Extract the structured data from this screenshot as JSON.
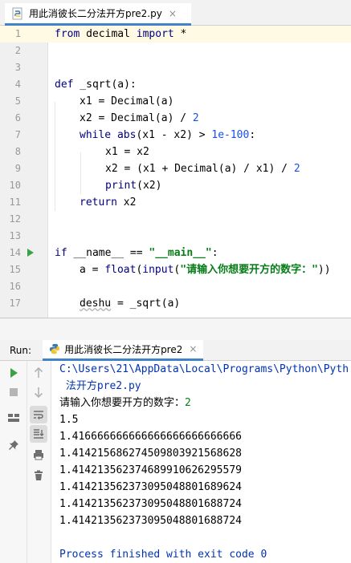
{
  "editor_tab": {
    "label": "用此消彼长二分法开方pre2.py",
    "close": "×"
  },
  "editor": {
    "lines": [
      {
        "n": "1"
      },
      {
        "n": "2"
      },
      {
        "n": "3"
      },
      {
        "n": "4"
      },
      {
        "n": "5"
      },
      {
        "n": "6"
      },
      {
        "n": "7"
      },
      {
        "n": "8"
      },
      {
        "n": "9"
      },
      {
        "n": "10"
      },
      {
        "n": "11"
      },
      {
        "n": "12"
      },
      {
        "n": "13"
      },
      {
        "n": "14"
      },
      {
        "n": "15"
      },
      {
        "n": "16"
      },
      {
        "n": "17"
      }
    ],
    "code": {
      "l1": {
        "kw1": "from",
        "mod": " decimal ",
        "kw2": "import",
        "rest": " *"
      },
      "l4": {
        "kw": "def",
        "rest": " _sqrt(a):"
      },
      "l5": "x1 = Decimal(a)",
      "l6": {
        "pre": "x2 = Decimal(a) / ",
        "num": "2"
      },
      "l7": {
        "kw": "while",
        "bi": " abs",
        "pre": "(x1 - x2) > ",
        "num": "1e-100",
        "post": ":"
      },
      "l8": "x1 = x2",
      "l9": {
        "pre": "x2 = (x1 + Decimal(a) / x1) / ",
        "num": "2"
      },
      "l10": {
        "bi": "print",
        "rest": "(x2)"
      },
      "l11": {
        "kw": "return",
        "rest": " x2"
      },
      "l14": {
        "kw": "if",
        "pre": " __name__ == ",
        "str": "\"__main__\"",
        "post": ":"
      },
      "l15": {
        "pre": "a = ",
        "bi1": "float",
        "mid": "(",
        "bi2": "input",
        "mid2": "(",
        "str": "\"请输入你想要开方的数字：\"",
        "post": "))"
      },
      "l17": {
        "var": "deshu",
        "rest": " = _sqrt(a)"
      }
    }
  },
  "run_panel": {
    "title": "Run:",
    "tab_label": "用此消彼长二分法开方pre2",
    "tab_close": "×",
    "console_lines": [
      {
        "text": "C:\\Users\\21\\AppData\\Local\\Programs\\Python\\Pyth",
        "type": "path"
      },
      {
        "text": " 法开方pre2.py",
        "type": "path"
      },
      {
        "prompt": "请输入你想要开方的数字：",
        "input": "2",
        "type": "prompt"
      },
      {
        "text": "1.5",
        "type": "out"
      },
      {
        "text": "1.416666666666666666666666666",
        "type": "out"
      },
      {
        "text": "1.414215686274509803921568628",
        "type": "out"
      },
      {
        "text": "1.414213562374689910626295579",
        "type": "out"
      },
      {
        "text": "1.414213562373095048801689624",
        "type": "out"
      },
      {
        "text": "1.414213562373095048801688724",
        "type": "out"
      },
      {
        "text": "1.414213562373095048801688724",
        "type": "out"
      },
      {
        "text": "",
        "type": "blank"
      },
      {
        "text": "Process finished with exit code 0",
        "type": "exit"
      }
    ]
  },
  "colors": {
    "keyword": "#000080",
    "number": "#1750eb",
    "string": "#067d17",
    "run_green": "#3ba244",
    "tab_underline": "#4083c9",
    "current_line": "#fffae3"
  }
}
